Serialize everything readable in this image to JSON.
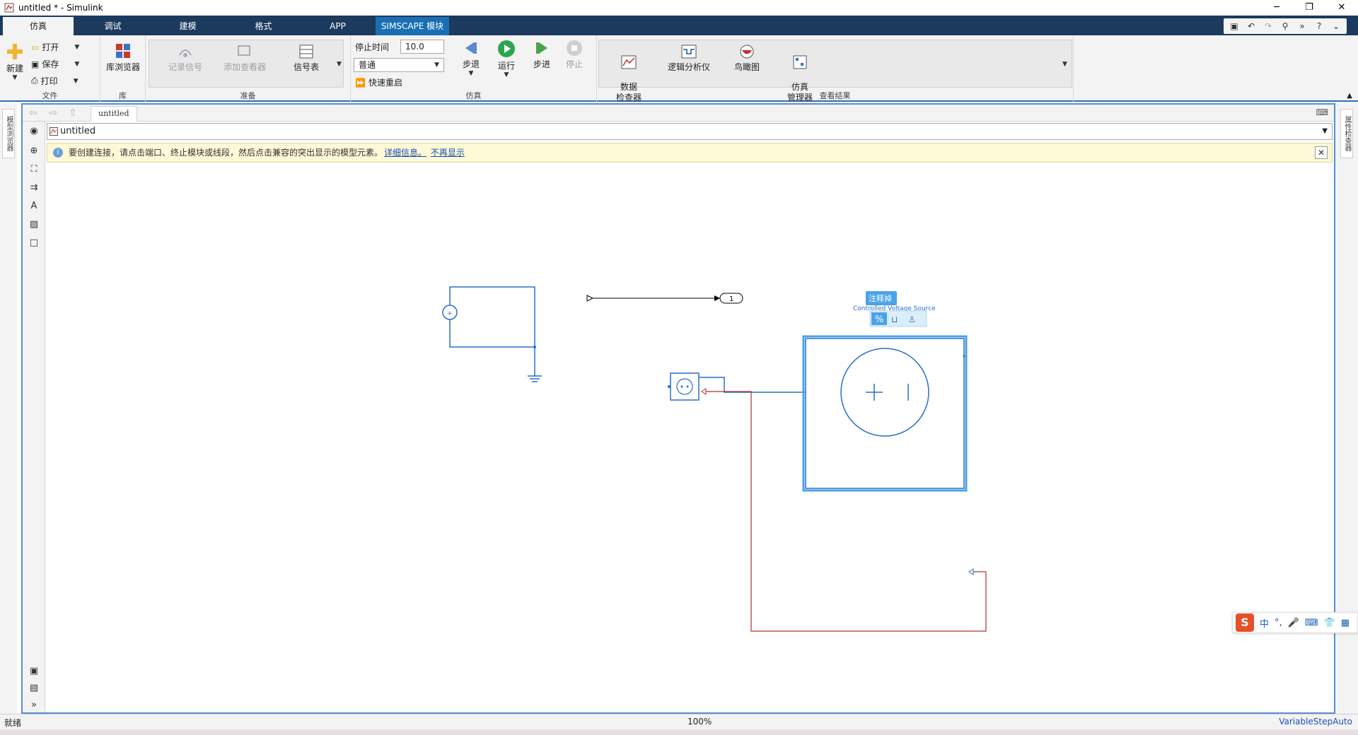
{
  "window": {
    "title": "untitled * - Simulink",
    "controls": [
      "─",
      "❐",
      "✕"
    ]
  },
  "tabs": [
    {
      "label": "仿真",
      "active": true
    },
    {
      "label": "调试"
    },
    {
      "label": "建模"
    },
    {
      "label": "格式"
    },
    {
      "label": "APP"
    },
    {
      "label": "SIMSCAPE 模块"
    }
  ],
  "ribbon": {
    "file": {
      "label": "文件",
      "new": "新建",
      "open": "打开",
      "save": "保存",
      "print": "打印"
    },
    "library": {
      "label": "库",
      "browser": "库浏览器"
    },
    "prepare": {
      "label": "准备",
      "log_signals": "记录信号",
      "add_viewer": "添加查看器",
      "signal_table": "信号表"
    },
    "simulate": {
      "label": "仿真",
      "stop_time_label": "停止时间",
      "stop_time_value": "10.0",
      "mode": "普通",
      "fast_restart": "快速重启",
      "step_back": "步退",
      "run": "运行",
      "step_forward": "步进",
      "stop": "停止"
    },
    "results": {
      "label": "查看结果",
      "data_inspector": "数据\n检查器",
      "logic_analyzer": "逻辑分析仪",
      "birds_eye": "鸟瞰图",
      "sim_manager": "仿真\n管理器"
    }
  },
  "side": {
    "left_tab": "模型浏览器",
    "right_tab": "属性检查器"
  },
  "editor": {
    "model_tab": "untitled",
    "address": "untitled",
    "info_message": "要创建连接，请点击端口、终止模块或线段，然后点击兼容的突出显示的模型元素。",
    "info_link_details": "详细信息。",
    "info_link_dismiss": "不再显示"
  },
  "canvas": {
    "outport_label": "1",
    "tooltip_label": "注释掉",
    "block_name_partial": "Controlled Voltage Source",
    "colors": {
      "block_blue": "#2b6fc8",
      "wire_red": "#b03030",
      "selection": "#4aa3e8"
    }
  },
  "status": {
    "left": "就绪",
    "zoom": "100%",
    "solver": "VariableStepAuto"
  },
  "ime": {
    "items": [
      "中",
      "°,",
      "🎤",
      "⌨",
      "👕",
      "▦"
    ]
  }
}
